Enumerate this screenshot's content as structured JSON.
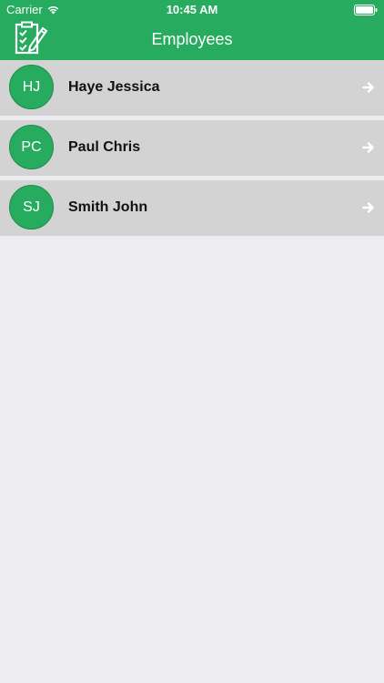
{
  "status_bar": {
    "carrier": "Carrier",
    "time": "10:45 AM",
    "wifi_icon": "wifi-icon",
    "battery_icon": "battery-icon"
  },
  "nav": {
    "title": "Employees",
    "logo_icon": "checklist-edit-icon"
  },
  "colors": {
    "brand_green": "#27AB5F",
    "row_bg": "#D3D3D3",
    "page_bg": "#ECECF1"
  },
  "employees": [
    {
      "initials": "HJ",
      "name": "Haye Jessica"
    },
    {
      "initials": "PC",
      "name": "Paul Chris"
    },
    {
      "initials": "SJ",
      "name": "Smith John"
    }
  ]
}
